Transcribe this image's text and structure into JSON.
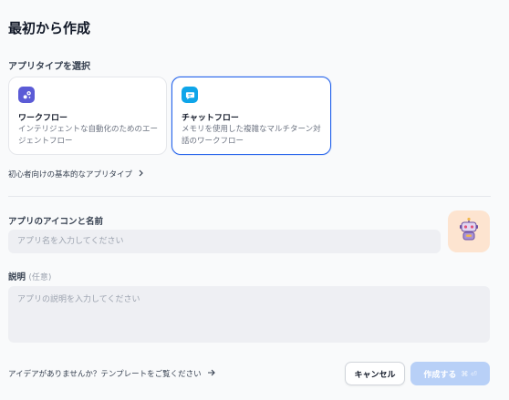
{
  "dialog": {
    "title": "最初から作成"
  },
  "app_type": {
    "label": "アプリタイプを選択",
    "options": [
      {
        "title": "ワークフロー",
        "description": "インテリジェントな自動化のためのエージェントフロー",
        "icon": "workflow-icon",
        "color": "#5b5bd6"
      },
      {
        "title": "チャットフロー",
        "description": "メモリを使用した複雑なマルチターン対話のワークフロー",
        "icon": "chatflow-icon",
        "color": "#0ea5e9",
        "selected": true
      }
    ],
    "beginner_link": "初心者向けの基本的なアプリタイプ"
  },
  "name_field": {
    "label": "アプリのアイコンと名前",
    "placeholder": "アプリ名を入力してください"
  },
  "avatar": {
    "icon": "robot-icon",
    "background": "#fde4d0"
  },
  "description_field": {
    "label": "説明",
    "optional": "(任意)",
    "placeholder": "アプリの説明を入力してください"
  },
  "footer": {
    "template_link": "アイデアがありませんか？テンプレートをご覧ください",
    "cancel_label": "キャンセル",
    "create_label": "作成する",
    "create_shortcut": "⌘ ⏎"
  },
  "colors": {
    "accent": "#2563eb",
    "create_disabled": "#b8d0f7"
  }
}
